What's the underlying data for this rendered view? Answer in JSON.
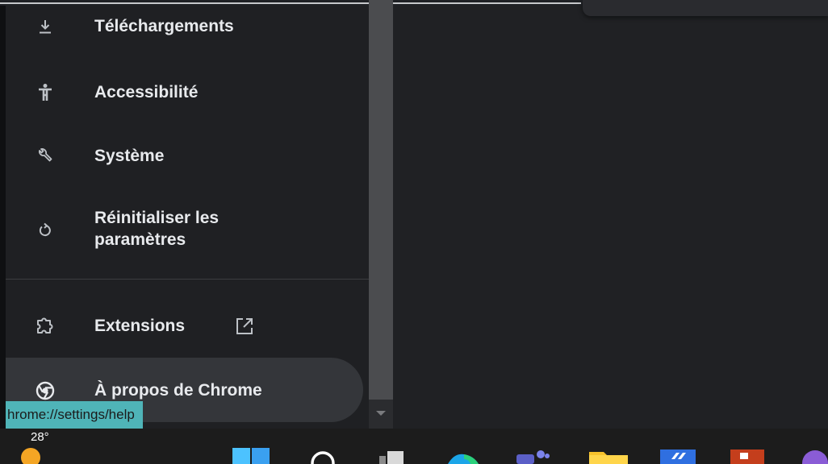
{
  "sidebar": {
    "items": [
      {
        "label": "Téléchargements",
        "icon": "download-icon"
      },
      {
        "label": "Accessibilité",
        "icon": "accessibility-icon"
      },
      {
        "label": "Système",
        "icon": "wrench-icon"
      },
      {
        "label_line1": "Réinitialiser les",
        "label_line2": "paramètres",
        "icon": "reset-icon"
      },
      {
        "label": "Extensions",
        "icon": "extension-puzzle-icon",
        "trailing_icon": "open-in-new-icon"
      },
      {
        "label": "À propos de Chrome",
        "icon": "chrome-icon"
      }
    ]
  },
  "tooltip": {
    "text": "hrome://settings/help"
  },
  "taskbar": {
    "weather_temp": "28°"
  },
  "colors": {
    "sidebar_bg": "#1f2023",
    "content_bg": "#202124",
    "text": "#e8eaed",
    "tooltip_bg": "#4fb4b8"
  }
}
